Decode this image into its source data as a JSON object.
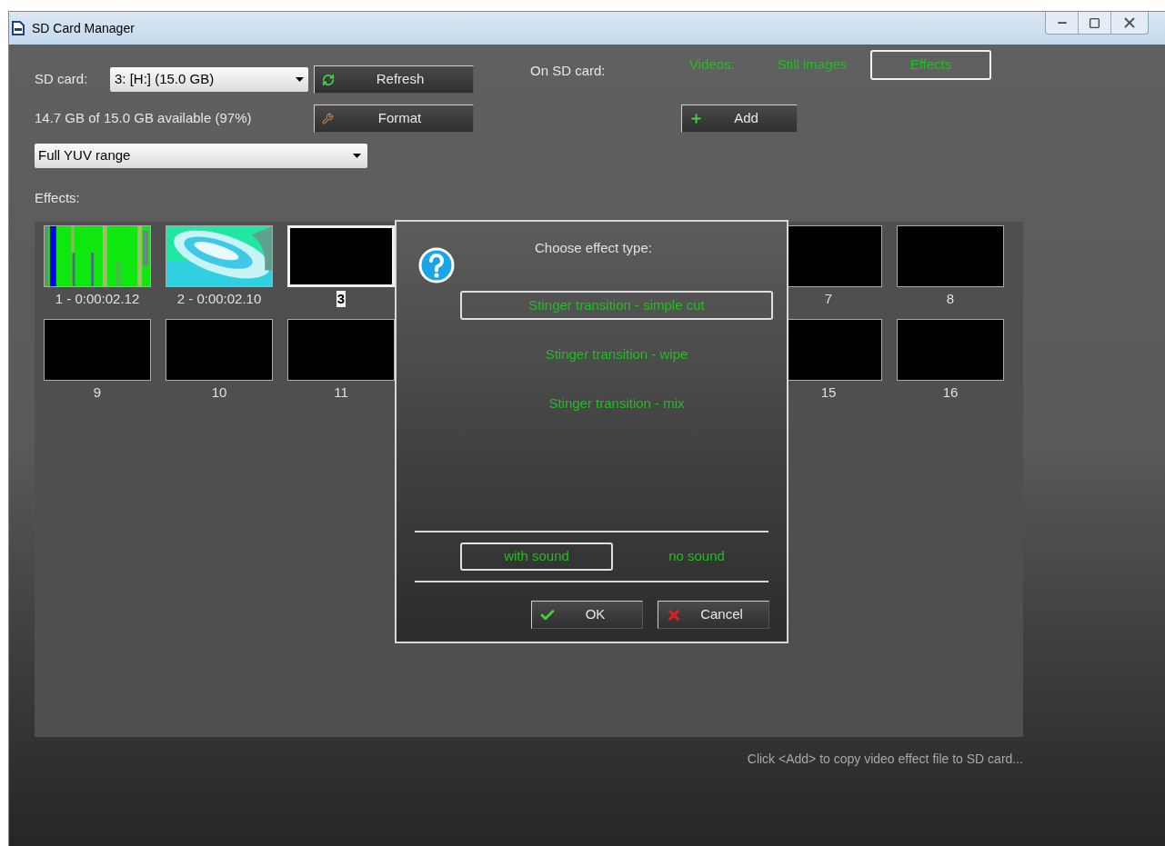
{
  "window": {
    "title": "SD Card Manager"
  },
  "sd_card": {
    "label": "SD card:",
    "value": "3: [H:] (15.0 GB)"
  },
  "buttons": [
    {
      "kind": "refresh",
      "label": "Refresh"
    },
    {
      "kind": "format",
      "label": "Format"
    }
  ],
  "capacity": "14.7 GB of 15.0 GB available (97%)",
  "range_select": {
    "value": "Full YUV range"
  },
  "on_sd_card": {
    "label": "On SD card:",
    "tabs": [
      {
        "label": "Videos:",
        "selected": false
      },
      {
        "label": "Still images",
        "selected": false
      },
      {
        "label": "Effects",
        "selected": true
      }
    ]
  },
  "add_button": {
    "label": "Add"
  },
  "effects_label": "Effects:",
  "effect_rows": [
    {
      "left": [
        {
          "label": "1 - 0:00:02.12",
          "kind": "picture",
          "selected": false
        },
        {
          "label": "2 - 0:00:02.10",
          "kind": "picture",
          "selected": false
        },
        {
          "label": "3",
          "kind": "empty",
          "selected": true
        }
      ],
      "right": [
        {
          "label": "7",
          "kind": "empty",
          "selected": false
        },
        {
          "label": "8",
          "kind": "empty",
          "selected": false
        }
      ]
    },
    {
      "left": [
        {
          "label": "9",
          "kind": "empty",
          "selected": false
        },
        {
          "label": "10",
          "kind": "empty",
          "selected": false
        },
        {
          "label": "11",
          "kind": "empty",
          "selected": false
        }
      ],
      "right": [
        {
          "label": "15",
          "kind": "empty",
          "selected": false
        },
        {
          "label": "16",
          "kind": "empty",
          "selected": false
        }
      ]
    }
  ],
  "status": "Click <Add> to copy video effect file to SD card...",
  "dialog": {
    "title": "Choose effect type:",
    "options": [
      {
        "label": "Stinger transition - simple cut",
        "selected": true
      },
      {
        "label": "Stinger transition - wipe",
        "selected": false
      },
      {
        "label": "Stinger transition - mix",
        "selected": false
      }
    ],
    "sound_options": [
      {
        "label": "with sound",
        "selected": true
      },
      {
        "label": "no sound",
        "selected": false
      }
    ],
    "buttons": [
      {
        "kind": "ok",
        "label": "OK"
      },
      {
        "kind": "cancel",
        "label": "Cancel"
      }
    ]
  }
}
